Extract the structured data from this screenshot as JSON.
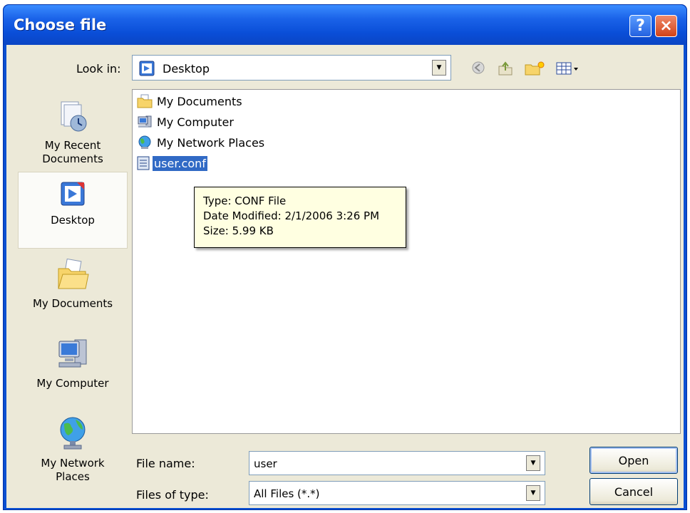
{
  "window": {
    "title": "Choose file",
    "help_glyph": "?",
    "close_glyph": "×"
  },
  "lookin": {
    "label": "Look in:",
    "value": "Desktop",
    "icon": "desktop-icon"
  },
  "toolbar": {
    "icons": [
      "back-icon",
      "up-folder-icon",
      "new-folder-icon",
      "view-menu-icon"
    ]
  },
  "places": [
    {
      "label_lines": [
        "My Recent",
        "Documents"
      ],
      "icon": "recent-documents-icon"
    },
    {
      "label_lines": [
        "Desktop"
      ],
      "icon": "desktop-icon",
      "active": true
    },
    {
      "label_lines": [
        "My Documents"
      ],
      "icon": "my-documents-icon"
    },
    {
      "label_lines": [
        "My Computer"
      ],
      "icon": "my-computer-icon"
    },
    {
      "label_lines": [
        "My Network",
        "Places"
      ],
      "icon": "network-places-icon"
    }
  ],
  "files": [
    {
      "name": "My Documents",
      "icon": "folder-documents-icon"
    },
    {
      "name": "My Computer",
      "icon": "computer-icon"
    },
    {
      "name": "My Network Places",
      "icon": "network-icon"
    },
    {
      "name": "user.conf",
      "icon": "file-icon",
      "selected": true
    }
  ],
  "tooltip": {
    "type": "Type: CONF File",
    "modified": "Date Modified: 2/1/2006 3:26 PM",
    "size": "Size: 5.99 KB"
  },
  "filename": {
    "label": "File name:",
    "value": "user"
  },
  "filetype": {
    "label": "Files of type:",
    "value": "All Files (*.*)"
  },
  "buttons": {
    "open": "Open",
    "cancel": "Cancel"
  },
  "colors": {
    "title_bar": "#0a4ed8",
    "selection": "#316ac5",
    "tooltip_bg": "#ffffe1",
    "dialog_bg": "#ece9d8"
  }
}
